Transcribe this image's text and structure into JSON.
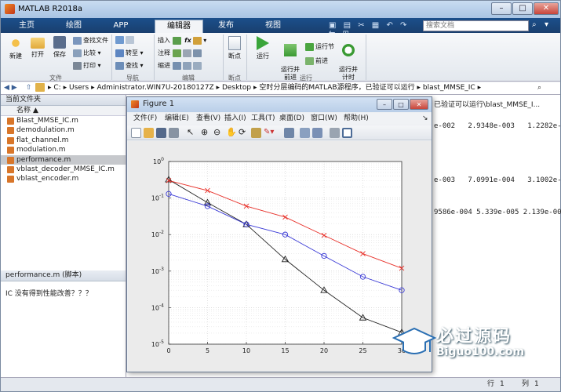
{
  "window": {
    "title": "MATLAB R2018a"
  },
  "tabs": [
    "主页",
    "绘图",
    "APP",
    "编辑器",
    "发布",
    "视图"
  ],
  "active_tab": "编辑器",
  "search": {
    "placeholder": "搜索文档"
  },
  "ribbon": {
    "file_group": {
      "label": "文件",
      "new": "新建",
      "open": "打开",
      "save": "保存",
      "find_files": "查找文件",
      "compare": "比较",
      "print": "打印"
    },
    "nav_group": {
      "label": "导航",
      "goto": "转至",
      "find": "查找"
    },
    "edit_group": {
      "label": "编辑",
      "insert": "插入",
      "comment": "注释",
      "indent": "缩进",
      "fx": "fx"
    },
    "breakpoint_group": {
      "label": "断点",
      "breakpoints": "断点"
    },
    "run_group": {
      "label": "运行",
      "run": "运行",
      "run_advance": "运行并\n前进",
      "run_section": "运行节",
      "advance": "前进",
      "run_time": "运行并\n计时"
    }
  },
  "address": {
    "segments": [
      "C:",
      "Users",
      "Administrator.WIN7U-20180127Z",
      "Desktop",
      "空时分层编码的MATLAB源程序，已验证可以运行",
      "blast_MMSE_IC"
    ]
  },
  "file_panel": {
    "title": "当前文件夹",
    "column": "名称",
    "files": [
      "Blast_MMSE_IC.m",
      "demodulation.m",
      "flat_channel.m",
      "modulation.m",
      "performance.m",
      "vblast_decoder_MMSE_IC.m",
      "vblast_encoder.m"
    ],
    "selected": "performance.m"
  },
  "details": {
    "title": "performance.m  (脚本)",
    "text": "IC 没有得到性能改善？？？"
  },
  "command_window": {
    "path_fragment": "已验证可以运行\\blast_MMSE_I...",
    "lines": [
      "e-002   2.9348e-003   1.2282e-00",
      "e-003   7.0991e-004   3.1002e-00",
      "9586e-004 5.339e-005 2.139e-005"
    ]
  },
  "statusbar": {
    "row_label": "行",
    "row": "1",
    "col_label": "列",
    "col": "1"
  },
  "figure": {
    "title": "Figure 1",
    "menu": [
      "文件(F)",
      "编辑(E)",
      "查看(V)",
      "插入(I)",
      "工具(T)",
      "桌面(D)",
      "窗口(W)",
      "帮助(H)"
    ]
  },
  "watermark": {
    "name": "必过源码",
    "url": "Biguo100.com"
  },
  "colors": {
    "black_series": "#222222",
    "red_series": "#e8312a",
    "blue_series": "#3a3ad6",
    "tab_bar": "#1b4f8b"
  },
  "chart_data": {
    "type": "line",
    "title": "",
    "xlabel": "",
    "ylabel": "",
    "xlim": [
      0,
      30
    ],
    "ylim": [
      1e-05,
      1
    ],
    "yscale": "log",
    "grid": true,
    "xticks": [
      "0",
      "5",
      "10",
      "15",
      "20",
      "25",
      "30"
    ],
    "yticks": [
      "10^0",
      "10^-1",
      "10^-2",
      "10^-3",
      "10^-4",
      "10^-5"
    ],
    "x": [
      0,
      5,
      10,
      15,
      20,
      25,
      30
    ],
    "series": [
      {
        "marker": "triangle",
        "color": "#222222",
        "values": [
          0.32,
          0.075,
          0.019,
          0.0021,
          0.0003,
          5.3e-05,
          2.1e-05
        ]
      },
      {
        "marker": "x",
        "color": "#e8312a",
        "values": [
          0.3,
          0.16,
          0.06,
          0.03,
          0.0095,
          0.003,
          0.0012
        ]
      },
      {
        "marker": "circle",
        "color": "#3a3ad6",
        "values": [
          0.13,
          0.06,
          0.019,
          0.01,
          0.0026,
          0.0007,
          0.0003
        ]
      }
    ]
  }
}
